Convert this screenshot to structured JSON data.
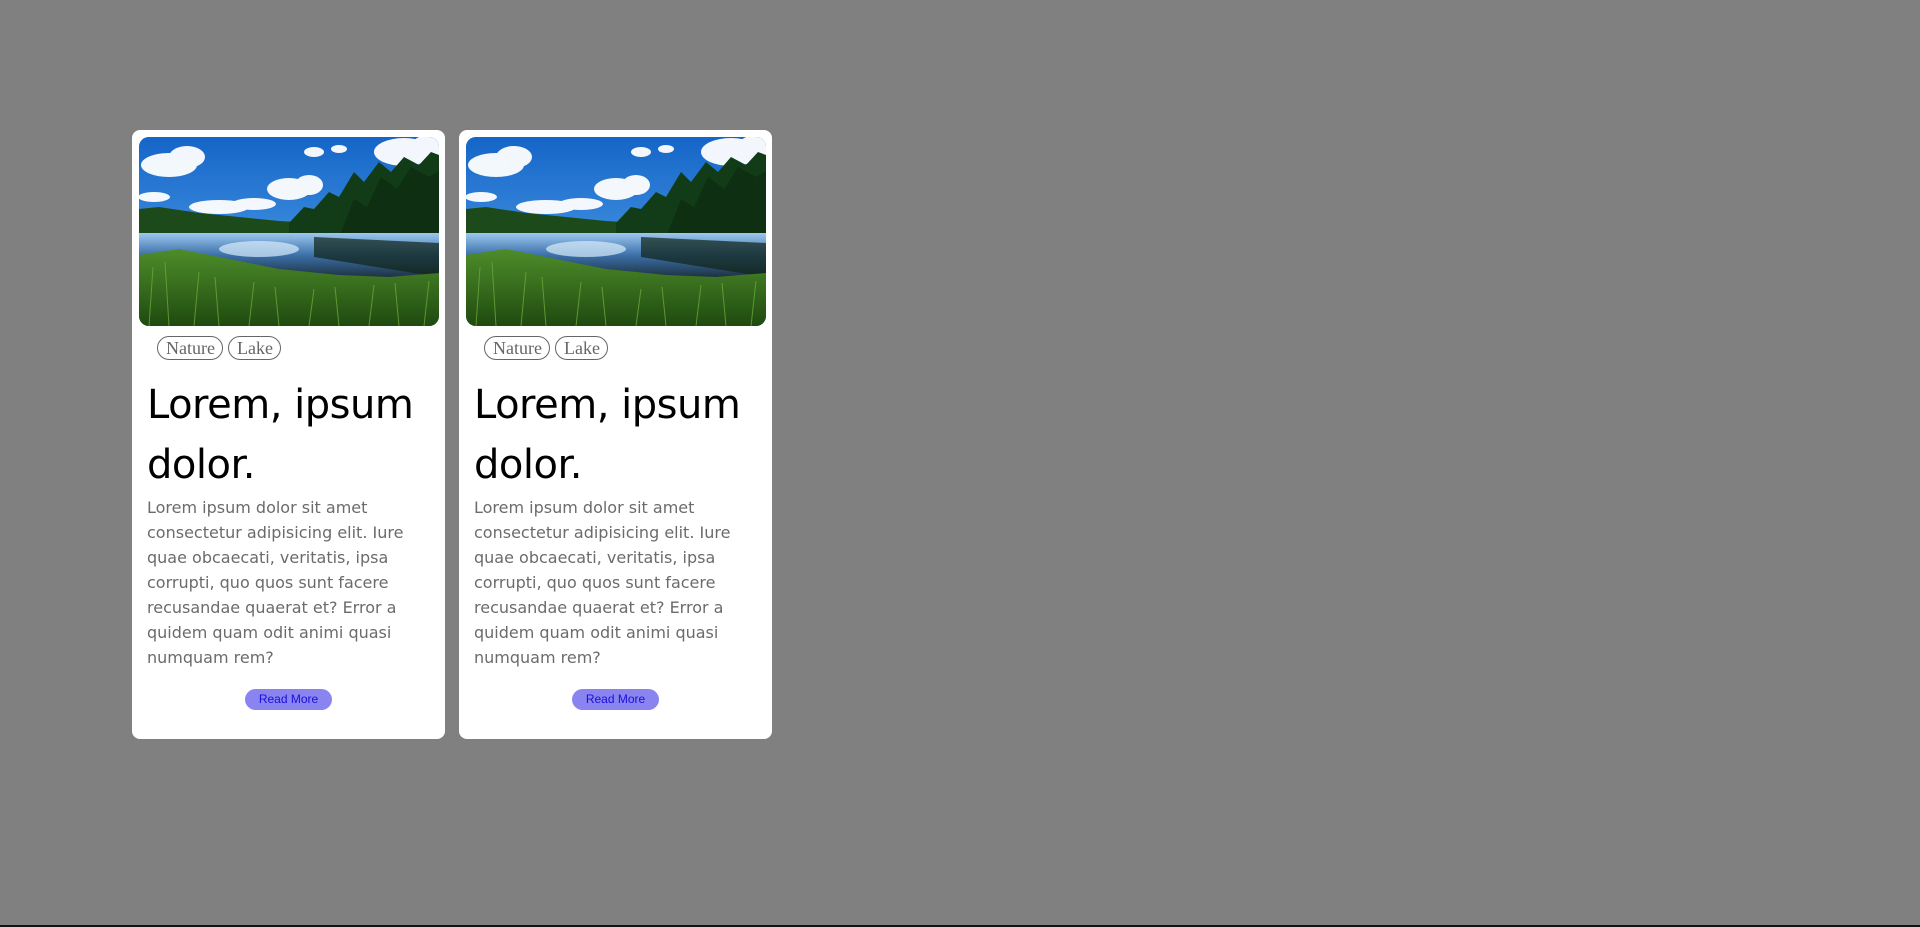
{
  "cards": [
    {
      "image_alt": "lake-landscape",
      "tags": [
        "Nature",
        "Lake"
      ],
      "title_line1": "Lorem, ipsum",
      "title_line2": "dolor.",
      "description": "Lorem ipsum dolor sit amet consectetur adipisicing elit. Iure quae obcaecati, veritatis, ipsa corrupti, quo quos sunt facere recusandae quaerat et? Error a quidem quam odit animi quasi numquam rem?",
      "button_label": "Read More"
    },
    {
      "image_alt": "lake-landscape",
      "tags": [
        "Nature",
        "Lake"
      ],
      "title_line1": "Lorem, ipsum",
      "title_line2": "dolor.",
      "description": "Lorem ipsum dolor sit amet consectetur adipisicing elit. Iure quae obcaecati, veritatis, ipsa corrupti, quo quos sunt facere recusandae quaerat et? Error a quidem quam odit animi quasi numquam rem?",
      "button_label": "Read More"
    }
  ],
  "colors": {
    "background": "#808080",
    "card": "#ffffff",
    "button_bg": "#8a84f0",
    "button_text": "#1a0fd6",
    "tag_border": "#666666",
    "description_text": "#6b6b6b"
  }
}
